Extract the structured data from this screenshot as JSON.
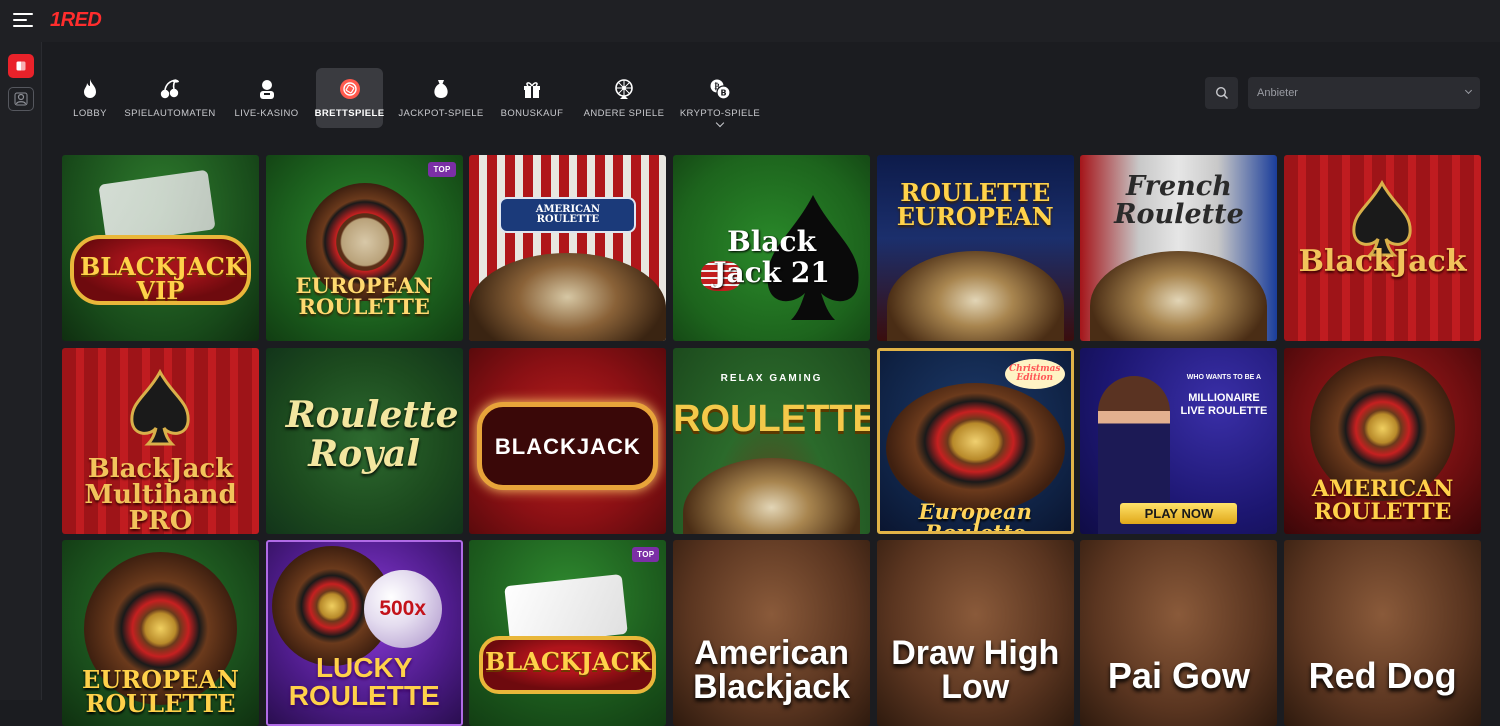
{
  "brand": {
    "logo_prefix": "1",
    "logo_text": "RED"
  },
  "nav": {
    "items": [
      {
        "label": "LOBBY",
        "icon": "flame-icon"
      },
      {
        "label": "SPIELAUTOMATEN",
        "icon": "cherry-icon"
      },
      {
        "label": "LIVE-KASINO",
        "icon": "dealer-icon"
      },
      {
        "label": "BRETTSPIELE",
        "icon": "chip-icon",
        "active": true
      },
      {
        "label": "JACKPOT-SPIELE",
        "icon": "money-bag-icon"
      },
      {
        "label": "BONUSKAUF",
        "icon": "gift-icon"
      },
      {
        "label": "ANDERE SPIELE",
        "icon": "wheel-icon"
      },
      {
        "label": "KRYPTO-SPIELE",
        "icon": "crypto-coins-icon",
        "has_dropdown": true
      }
    ]
  },
  "filters": {
    "provider_placeholder": "Anbieter"
  },
  "games": [
    {
      "title": "BLACKJACK VIP"
    },
    {
      "title": "EUROPEAN ROULETTE",
      "badge": "TOP"
    },
    {
      "title": "AMERICAN ROULETTE"
    },
    {
      "title": "Black Jack 21"
    },
    {
      "title": "ROULETTE EUROPEAN"
    },
    {
      "title": "French Roulette"
    },
    {
      "title": "BlackJack"
    },
    {
      "title": "BlackJack Multihand PRO"
    },
    {
      "title": "Roulette Royal"
    },
    {
      "title": "BLACKJACK"
    },
    {
      "title": "ROULETTE",
      "provider": "RELAX GAMING"
    },
    {
      "title": "European Roulette",
      "edition": "Christmas Edition"
    },
    {
      "title": "MILLIONAIRE LIVE ROULETTE",
      "sub": "WHO WANTS TO BE A",
      "cta": "PLAY NOW"
    },
    {
      "title": "AMERICAN ROULETTE"
    },
    {
      "title": "EUROPEAN ROULETTE"
    },
    {
      "title": "LUCKY ROULETTE",
      "multiplier": "500x"
    },
    {
      "title": "BLACKJACK",
      "badge": "TOP"
    },
    {
      "title": "American Blackjack"
    },
    {
      "title": "Draw High Low"
    },
    {
      "title": "Pai Gow"
    },
    {
      "title": "Red Dog"
    }
  ],
  "colors": {
    "accent": "#e9222a",
    "badge": "#7b2fa6",
    "background": "#1b1c20"
  }
}
